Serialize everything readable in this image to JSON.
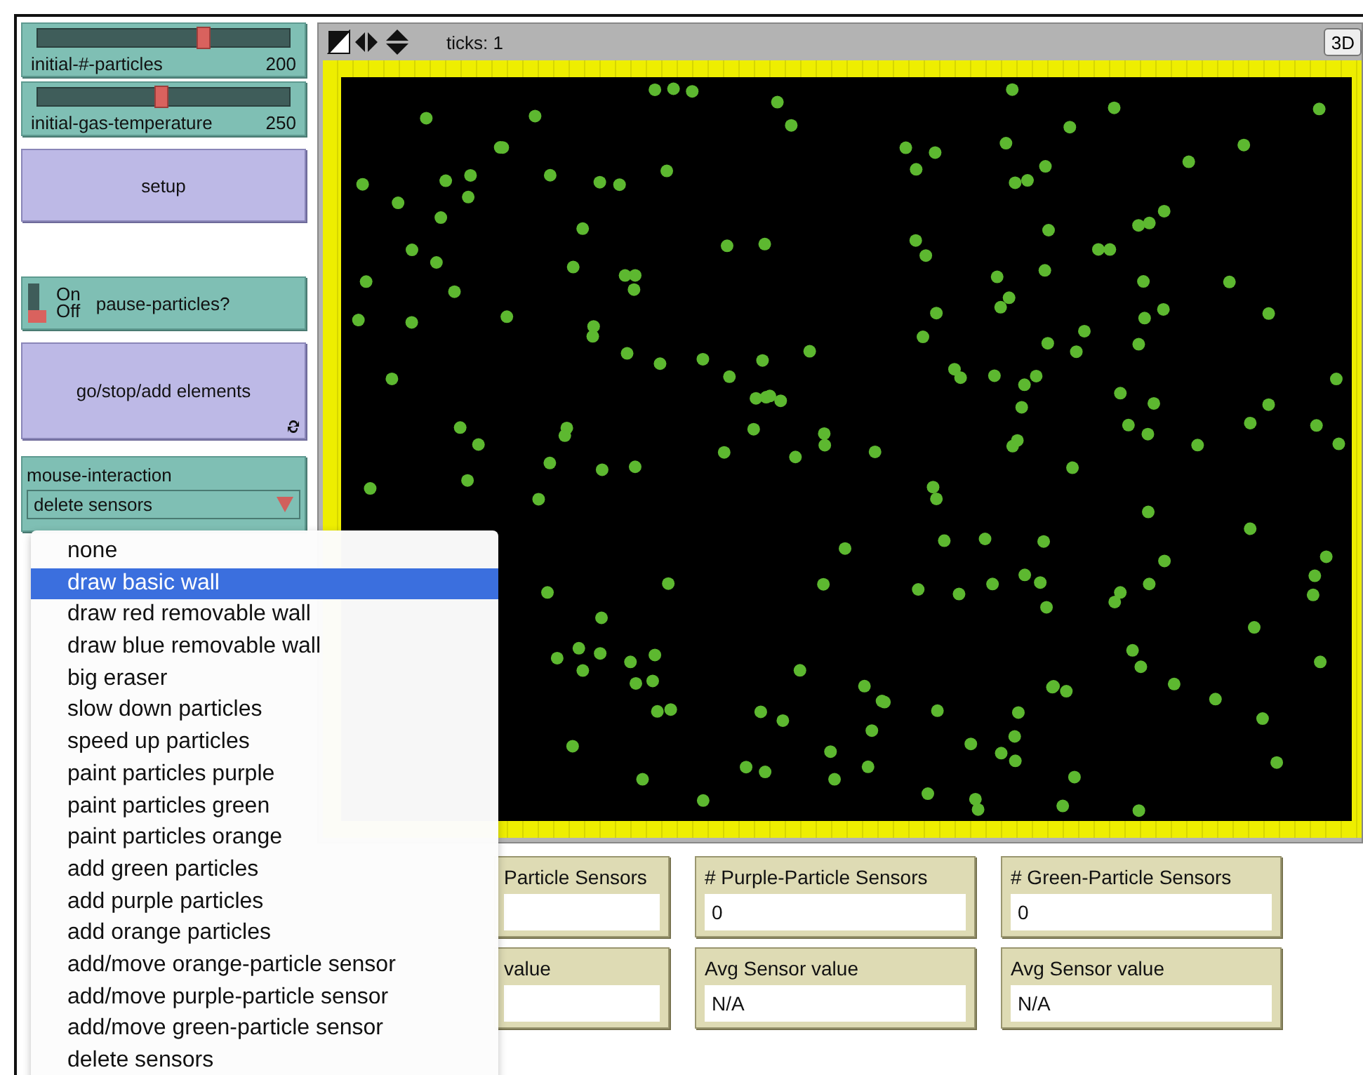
{
  "sliders": [
    {
      "label": "initial-#-particles",
      "value": "200",
      "level": 0.66
    },
    {
      "label": "initial-gas-temperature",
      "value": "250",
      "level": 0.49
    }
  ],
  "setup_button": {
    "label": "setup"
  },
  "switch": {
    "on_label": "On",
    "off_label": "Off",
    "label": "pause-particles?",
    "on": false
  },
  "go_button": {
    "label": "go/stop/add elements",
    "forever": true
  },
  "chooser": {
    "label": "mouse-interaction",
    "value": "delete sensors"
  },
  "view": {
    "ticks": "ticks: 1",
    "button_3d": "3D"
  },
  "menu": {
    "items": [
      {
        "label": "none",
        "selected": false
      },
      {
        "label": "draw basic wall",
        "selected": true
      },
      {
        "label": "draw red removable wall",
        "selected": false
      },
      {
        "label": "draw blue removable wall",
        "selected": false
      },
      {
        "label": "big eraser",
        "selected": false
      },
      {
        "label": "slow down particles",
        "selected": false
      },
      {
        "label": "speed up particles",
        "selected": false
      },
      {
        "label": "paint particles purple",
        "selected": false
      },
      {
        "label": "paint particles green",
        "selected": false
      },
      {
        "label": "paint particles orange",
        "selected": false
      },
      {
        "label": "add green particles",
        "selected": false
      },
      {
        "label": "add purple particles",
        "selected": false
      },
      {
        "label": "add orange particles",
        "selected": false
      },
      {
        "label": "add/move orange-particle sensor",
        "selected": false
      },
      {
        "label": "add/move purple-particle sensor",
        "selected": false
      },
      {
        "label": "add/move green-particle sensor",
        "selected": false
      },
      {
        "label": "delete sensors",
        "selected": false
      }
    ]
  },
  "monitors": [
    [
      {
        "label": "Particle Sensors"
      },
      {
        "label": "value"
      }
    ],
    [
      {
        "label": "# Purple-Particle Sensors",
        "value": "0"
      },
      {
        "label": "Avg Sensor value",
        "value": "N/A"
      }
    ],
    [
      {
        "label": "# Green-Particle Sensors",
        "value": "0"
      },
      {
        "label": "Avg Sensor value",
        "value": "N/A"
      }
    ]
  ]
}
